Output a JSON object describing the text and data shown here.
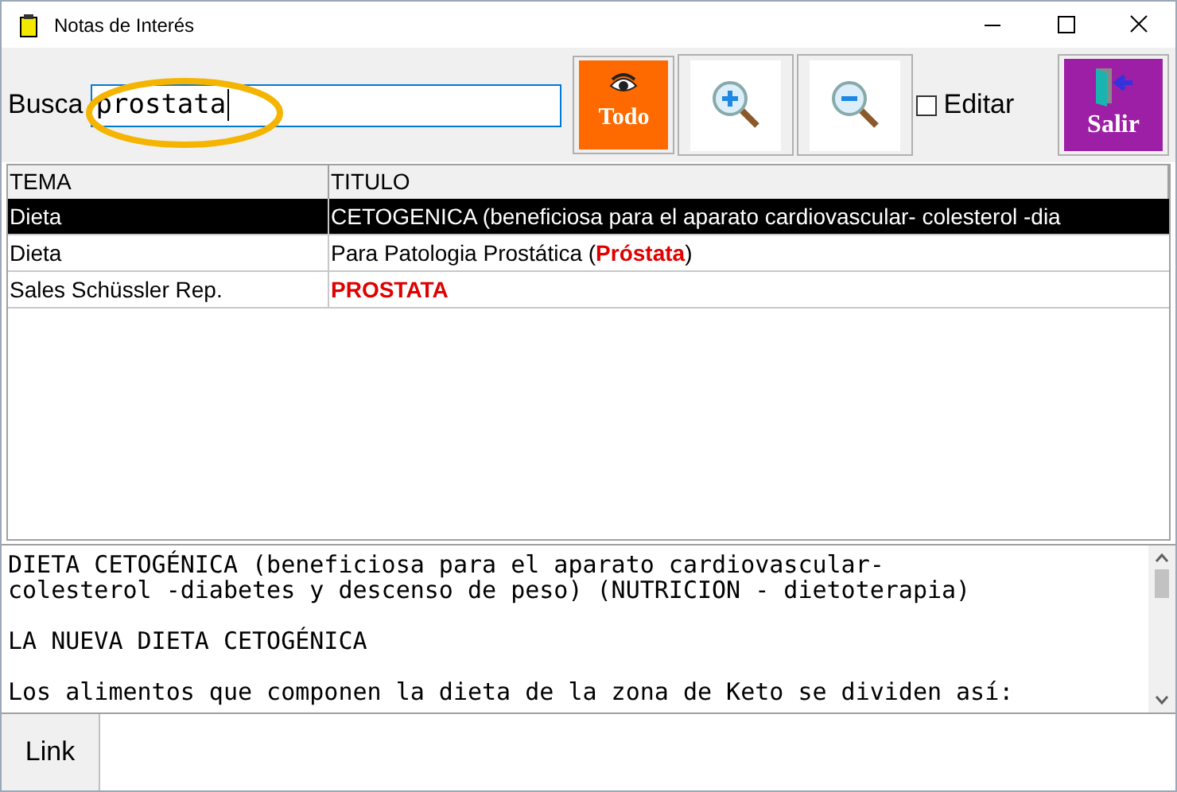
{
  "window": {
    "title": "Notas de Interés"
  },
  "toolbar": {
    "search_label": "Busca",
    "search_value": "prostata",
    "all_button": "Todo",
    "edit_checkbox": {
      "label": "Editar",
      "checked": false
    },
    "exit_button": "Salir"
  },
  "table": {
    "columns": [
      "TEMA",
      "TITULO"
    ],
    "rows": [
      {
        "tema": "Dieta",
        "titulo": "CETOGENICA (beneficiosa para el aparato cardiovascular- colesterol -dia",
        "selected": true,
        "emphasis": false
      },
      {
        "tema": "Dieta",
        "titulo": "Para Patologia Prostática (**Próstata**)",
        "selected": false,
        "emphasis": false
      },
      {
        "tema": "Sales Schüssler Rep.",
        "titulo": "PROSTATA",
        "selected": false,
        "emphasis": true
      }
    ]
  },
  "note": {
    "paragraphs": [
      [
        "DIETA CETOGÉNICA (beneficiosa para el aparato cardiovascular-",
        "colesterol -diabetes y descenso de peso) (NUTRICION - dietoterapia)"
      ],
      [
        "LA NUEVA DIETA CETOGÉNICA"
      ],
      [
        "Los alimentos que componen la dieta de la zona de Keto se dividen así:"
      ]
    ]
  },
  "link": {
    "label": "Link"
  }
}
